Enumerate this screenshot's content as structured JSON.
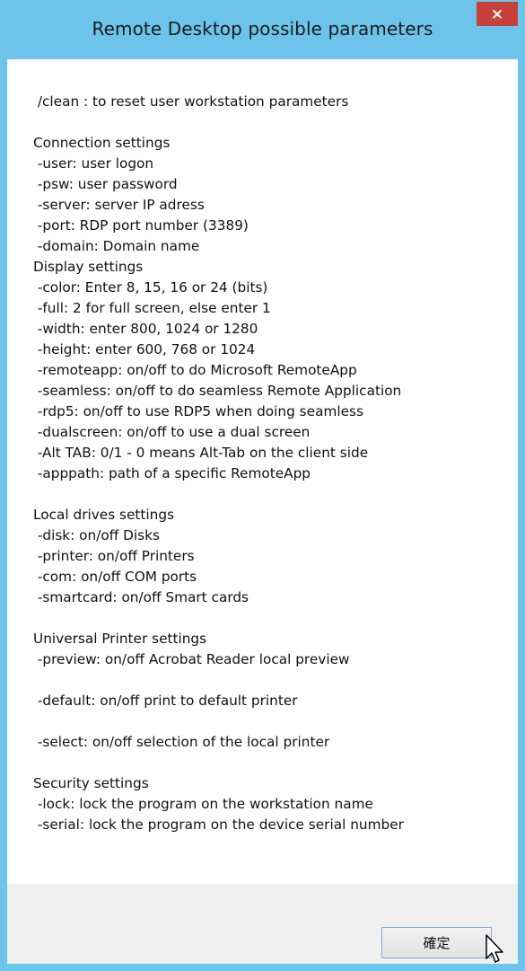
{
  "window": {
    "title": "Remote Desktop possible parameters",
    "close_label": "×"
  },
  "content": {
    "clean_line": " /clean : to reset user workstation parameters",
    "connection": {
      "heading": "Connection settings",
      "items": [
        " -user: user logon",
        " -psw: user password",
        " -server: server IP adress",
        " -port: RDP port number (3389)",
        " -domain: Domain name"
      ]
    },
    "display": {
      "heading": "Display settings",
      "items": [
        " -color: Enter 8, 15, 16 or 24 (bits)",
        " -full: 2 for full screen, else enter 1",
        " -width: enter 800, 1024 or 1280",
        " -height: enter 600, 768 or 1024",
        " -remoteapp: on/off to do Microsoft RemoteApp",
        " -seamless: on/off to do seamless Remote Application",
        " -rdp5: on/off to use RDP5 when doing seamless",
        " -dualscreen: on/off to use a dual screen",
        " -Alt TAB: 0/1 - 0 means Alt-Tab on the client side",
        " -apppath: path of a specific RemoteApp"
      ]
    },
    "local_drives": {
      "heading": "Local drives settings",
      "items": [
        " -disk: on/off Disks",
        " -printer: on/off Printers",
        " -com: on/off COM ports",
        " -smartcard: on/off Smart cards"
      ]
    },
    "universal_printer": {
      "heading": "Universal Printer settings",
      "preview": " -preview: on/off Acrobat Reader local preview",
      "default": " -default: on/off print to default printer",
      "select": " -select: on/off selection of the local printer"
    },
    "security": {
      "heading": "Security settings",
      "items": [
        " -lock: lock the program on the workstation name",
        " -serial: lock the program on the device serial number"
      ]
    }
  },
  "footer": {
    "ok_label": "確定"
  },
  "icons": {
    "close": "close-icon",
    "cursor": "mouse-pointer-icon"
  },
  "colors": {
    "titlebar": "#6cc4ea",
    "close_button": "#c7403a",
    "footer": "#f0f0f0",
    "button_border": "#7fa7d8"
  }
}
